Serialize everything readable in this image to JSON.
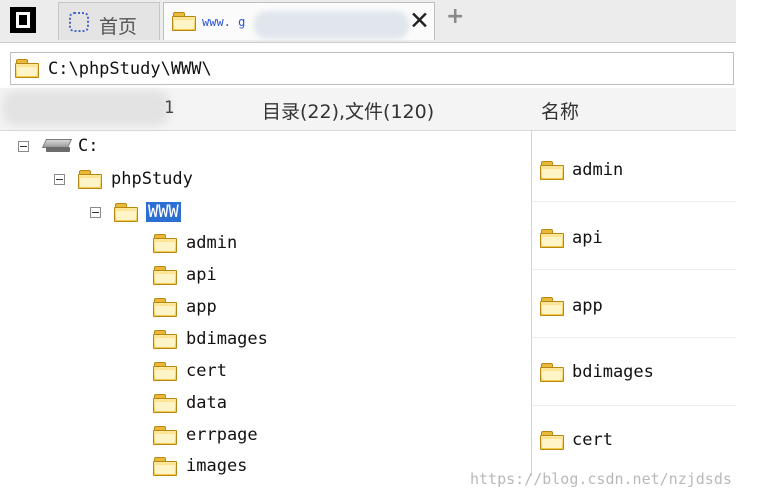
{
  "tabs": {
    "home_label": "首页",
    "active_label": "www. g",
    "new_tab_symbol": "+",
    "close_symbol": "✕"
  },
  "address": {
    "path": "C:\\phpStudy\\WWW\\"
  },
  "header": {
    "count_fragment": "1",
    "summary": "目录(22),文件(120)",
    "name_column": "名称"
  },
  "tree": {
    "drive": "C:",
    "level1": "phpStudy",
    "level2": "WWW",
    "children": [
      "admin",
      "api",
      "app",
      "bdimages",
      "cert",
      "data",
      "errpage",
      "images"
    ]
  },
  "files": [
    "admin",
    "api",
    "app",
    "bdimages",
    "cert"
  ],
  "watermark": "https://blog.csdn.net/nzjdsds",
  "colors": {
    "selection": "#2d6ed3",
    "folder": "#f6c94a",
    "link": "#2a55d6"
  },
  "icons": {
    "app": "app-logo-icon",
    "home": "home-icon",
    "folder": "folder-icon",
    "drive": "drive-icon",
    "close": "close-icon",
    "add": "plus-icon"
  }
}
